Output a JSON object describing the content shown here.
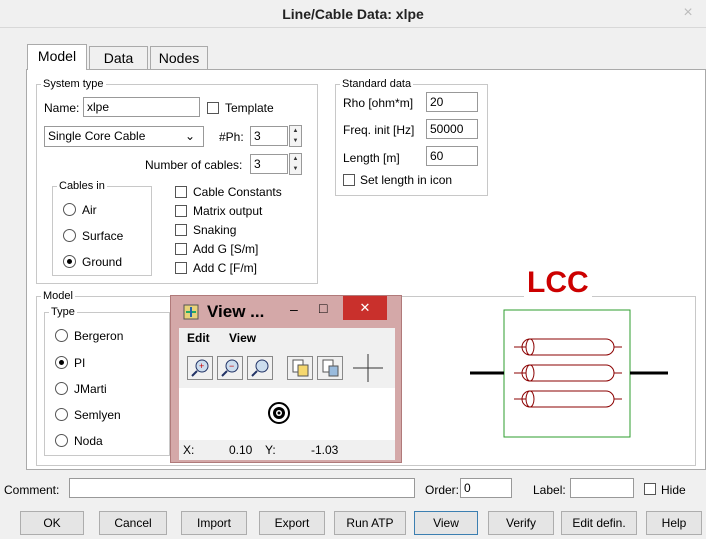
{
  "window": {
    "title": "Line/Cable Data: xlpe",
    "close": "×"
  },
  "tabs": [
    {
      "label": "Model"
    },
    {
      "label": "Data"
    },
    {
      "label": "Nodes"
    }
  ],
  "system_type": {
    "legend": "System type",
    "name_label": "Name:",
    "name_value": "xlpe",
    "template_label": "Template",
    "cable_type": "Single Core Cable",
    "phases_label": "#Ph:",
    "phases_value": "3",
    "num_cables_label": "Number of cables:",
    "num_cables_value": "3"
  },
  "cables_in": {
    "legend": "Cables in",
    "options": [
      "Air",
      "Surface",
      "Ground"
    ],
    "selected": "Ground"
  },
  "checkboxes": [
    "Cable Constants",
    "Matrix output",
    "Snaking",
    "Add G [S/m]",
    "Add C [F/m]"
  ],
  "standard_data": {
    "legend": "Standard data",
    "rho_label": "Rho [ohm*m]",
    "rho_value": "20",
    "freq_label": "Freq. init [Hz]",
    "freq_value": "50000",
    "length_label": "Length [m]",
    "length_value": "60",
    "set_length_label": "Set length in icon"
  },
  "model": {
    "legend": "Model",
    "type_legend": "Type",
    "options": [
      "Bergeron",
      "PI",
      "JMarti",
      "Semlyen",
      "Noda"
    ],
    "selected": "PI"
  },
  "lcc": {
    "label": "LCC",
    "accent": "#cc0000",
    "box_color": "#2e9e2e"
  },
  "view_popup": {
    "title": "View ...",
    "menu": [
      "Edit",
      "View"
    ],
    "x_label": "X:",
    "x_value": "0.10",
    "y_label": "Y:",
    "y_value": "-1.03",
    "minimize": "–",
    "maximize": "□",
    "close": "✕"
  },
  "bottom": {
    "comment_label": "Comment:",
    "comment_value": "",
    "order_label": "Order:",
    "order_value": "0",
    "label_label": "Label:",
    "label_value": "",
    "hide_label": "Hide"
  },
  "buttons": [
    "OK",
    "Cancel",
    "Import",
    "Export",
    "Run ATP",
    "View",
    "Verify",
    "Edit defin.",
    "Help"
  ]
}
